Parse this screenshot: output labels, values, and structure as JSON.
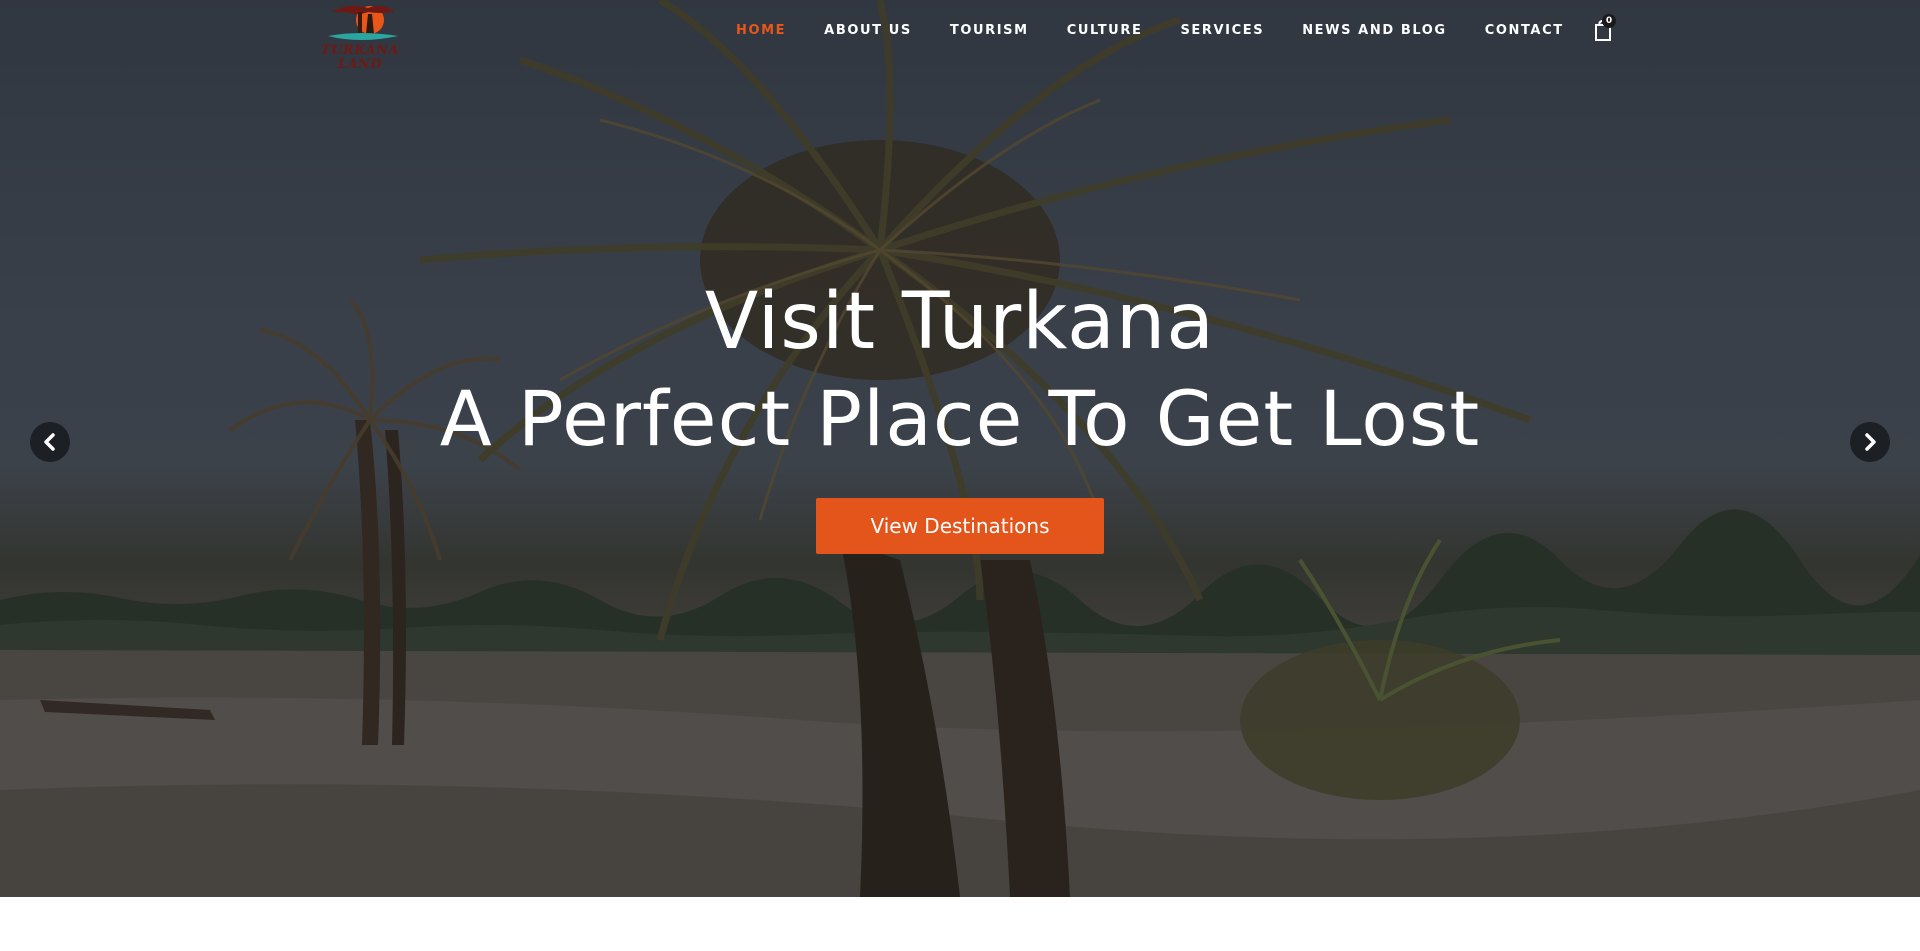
{
  "logo": {
    "line1": "TURKANA",
    "line2": "LAND"
  },
  "nav": {
    "items": [
      {
        "label": "HOME",
        "active": true
      },
      {
        "label": "ABOUT US",
        "active": false
      },
      {
        "label": "TOURISM",
        "active": false
      },
      {
        "label": "CULTURE",
        "active": false
      },
      {
        "label": "SERVICES",
        "active": false
      },
      {
        "label": "NEWS AND BLOG",
        "active": false
      },
      {
        "label": "CONTACT",
        "active": false
      }
    ],
    "cart_count": "0",
    "cart_icon": "shopping-bag-icon"
  },
  "hero": {
    "title": "Visit Turkana",
    "subtitle": "A Perfect Place To Get Lost",
    "cta_label": "View Destinations",
    "prev_icon": "chevron-left-icon",
    "next_icon": "chevron-right-icon"
  },
  "colors": {
    "accent": "#e4551b",
    "nav_active": "#e8561a",
    "logo_text": "#6e1a14",
    "arrow_bg": "#1c1f24"
  }
}
